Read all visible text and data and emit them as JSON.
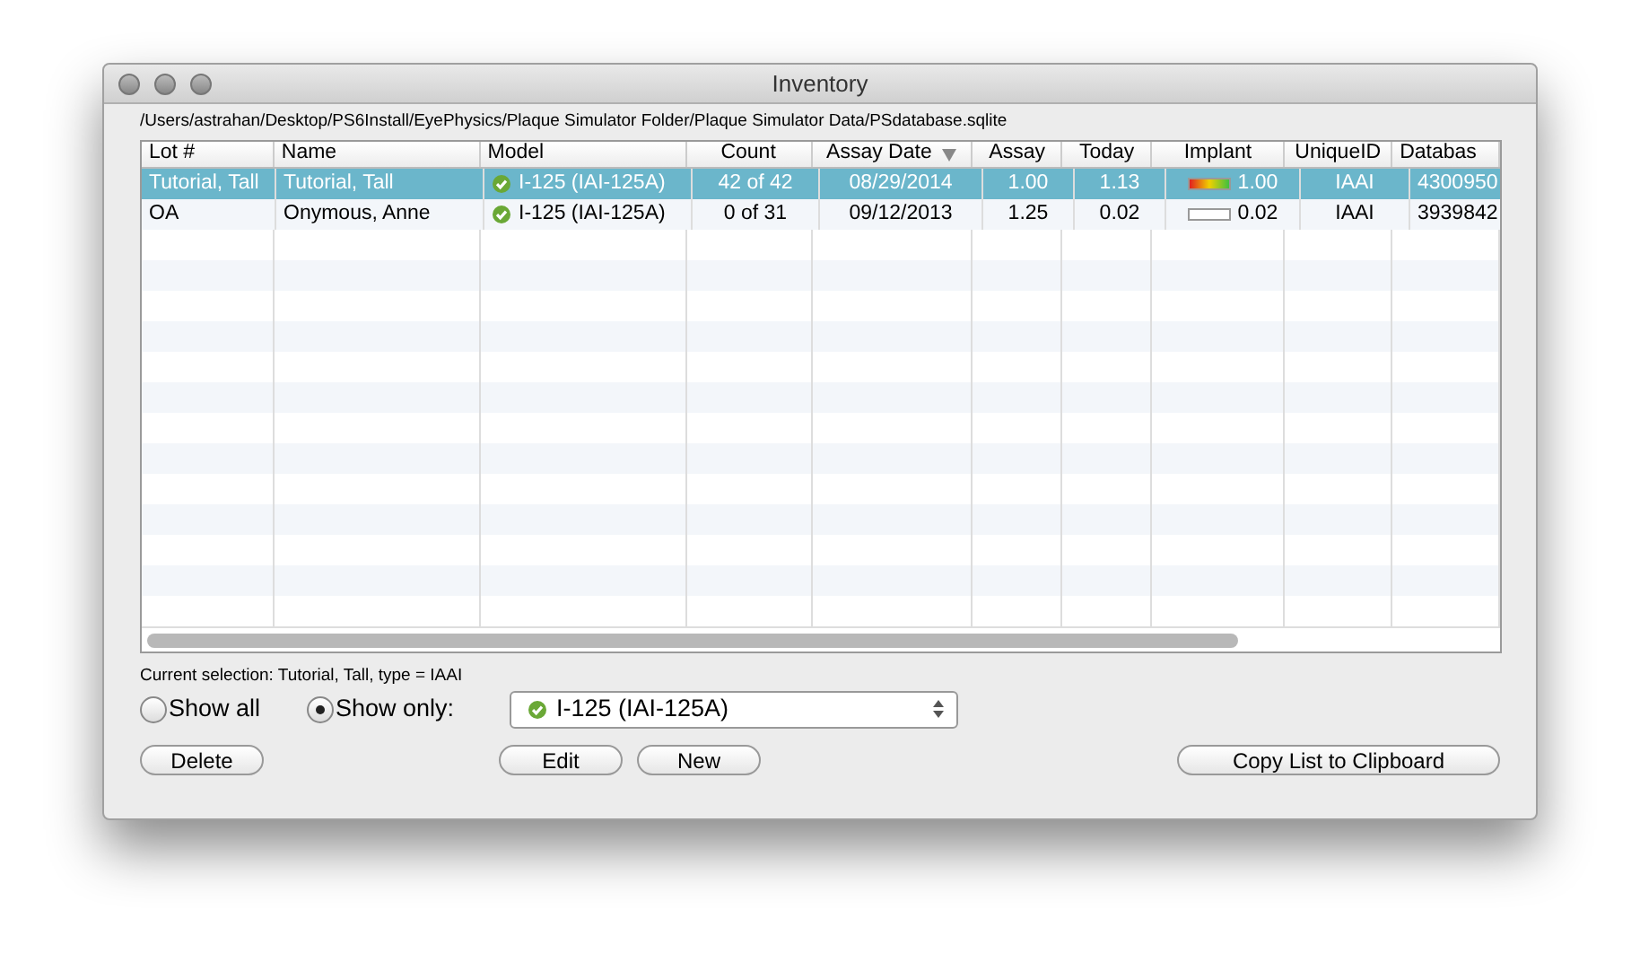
{
  "window": {
    "title": "Inventory"
  },
  "path": "/Users/astrahan/Desktop/PS6Install/EyePhysics/Plaque Simulator Folder/Plaque Simulator Data/PSdatabase.sqlite",
  "table": {
    "columns": [
      {
        "label": "Lot #",
        "sorted": false
      },
      {
        "label": "Name",
        "sorted": false
      },
      {
        "label": "Model",
        "sorted": false
      },
      {
        "label": "Count",
        "sorted": false
      },
      {
        "label": "Assay Date",
        "sorted": true
      },
      {
        "label": "Assay",
        "sorted": false
      },
      {
        "label": "Today",
        "sorted": false
      },
      {
        "label": "Implant",
        "sorted": false
      },
      {
        "label": "UniqueID",
        "sorted": false
      },
      {
        "label": "Databas",
        "sorted": false
      }
    ],
    "rows": [
      {
        "selected": true,
        "lot": "Tutorial, Tall",
        "name": "Tutorial, Tall",
        "model": "I-125 (IAI-125A)",
        "count": "42 of 42",
        "assay_date": "08/29/2014",
        "assay": "1.00",
        "today": "1.13",
        "implant": {
          "level": 1,
          "reading": "1.00"
        },
        "unique_id": "IAAI",
        "database": "4300950"
      },
      {
        "selected": false,
        "lot": "OA",
        "name": "Onymous, Anne",
        "model": "I-125 (IAI-125A)",
        "count": "0 of 31",
        "assay_date": "09/12/2013",
        "assay": "1.25",
        "today": "0.02",
        "implant": {
          "level": 0.02,
          "reading": "0.02"
        },
        "unique_id": "IAAI",
        "database": "3939842"
      }
    ]
  },
  "current_selection": "Current selection: Tutorial, Tall, type = IAAI",
  "filter": {
    "options": [
      {
        "label": "Show all",
        "selected": false
      },
      {
        "label": "Show only:",
        "selected": true
      }
    ],
    "model_popup": "I-125 (IAI-125A)"
  },
  "buttons": {
    "left": [
      "Delete"
    ],
    "middle": [
      "Edit",
      "New"
    ],
    "right": [
      "Copy List to Clipboard"
    ]
  }
}
